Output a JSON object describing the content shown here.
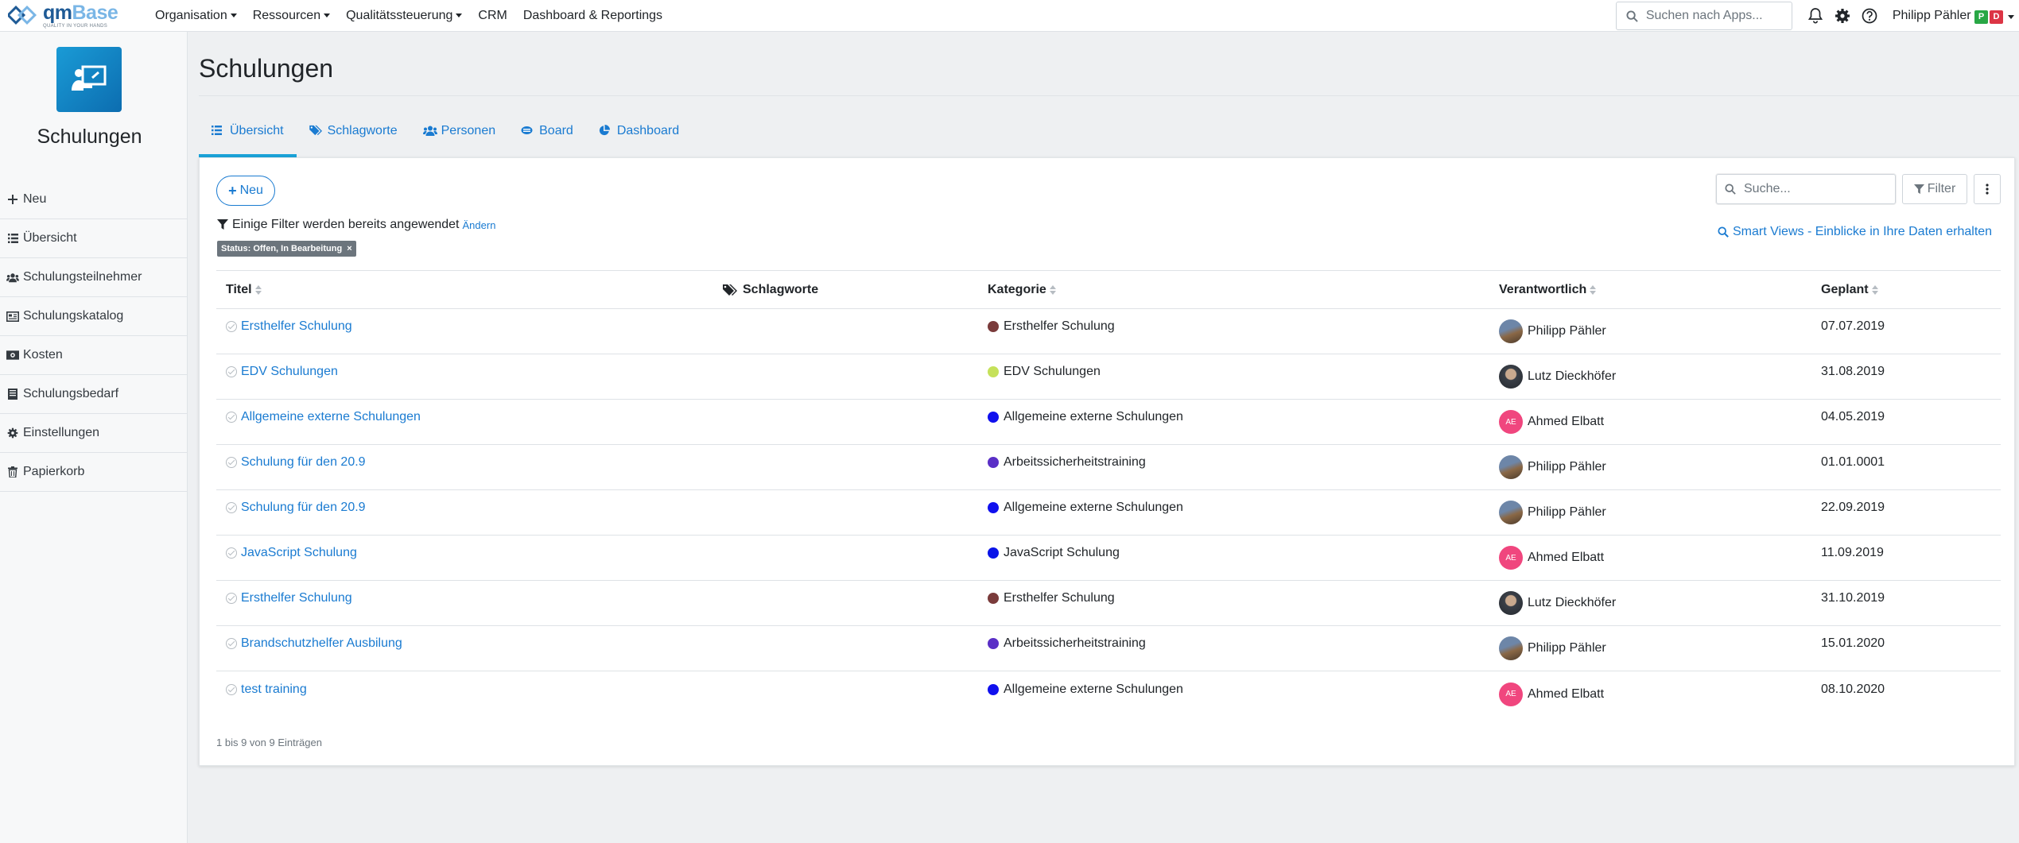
{
  "brand": {
    "name_part1": "qm",
    "name_part2": "Base",
    "tagline": "QUALITY IN YOUR HANDS"
  },
  "nav": {
    "items": [
      {
        "label": "Organisation",
        "dropdown": true
      },
      {
        "label": "Ressourcen",
        "dropdown": true
      },
      {
        "label": "Qualitätssteuerung",
        "dropdown": true
      },
      {
        "label": "CRM",
        "dropdown": false
      },
      {
        "label": "Dashboard & Reportings",
        "dropdown": false
      }
    ],
    "search_placeholder": "Suchen nach Apps...",
    "user_name": "Philipp Pähler",
    "badge_p": "P",
    "badge_d": "D"
  },
  "sidebar": {
    "app_title": "Schulungen",
    "items": [
      {
        "label": "Neu",
        "icon": "plus-icon"
      },
      {
        "label": "Übersicht",
        "icon": "list-icon"
      },
      {
        "label": "Schulungsteilnehmer",
        "icon": "users-icon"
      },
      {
        "label": "Schulungskatalog",
        "icon": "catalog-icon"
      },
      {
        "label": "Kosten",
        "icon": "money-icon"
      },
      {
        "label": "Schulungsbedarf",
        "icon": "book-icon"
      },
      {
        "label": "Einstellungen",
        "icon": "gear-icon"
      },
      {
        "label": "Papierkorb",
        "icon": "trash-icon"
      }
    ]
  },
  "page": {
    "title": "Schulungen"
  },
  "tabs": [
    {
      "label": "Übersicht",
      "icon": "list-icon",
      "active": true
    },
    {
      "label": "Schlagworte",
      "icon": "tags-icon",
      "active": false
    },
    {
      "label": "Personen",
      "icon": "users-icon",
      "active": false
    },
    {
      "label": "Board",
      "icon": "board-icon",
      "active": false
    },
    {
      "label": "Dashboard",
      "icon": "pie-chart-icon",
      "active": false
    }
  ],
  "toolbar": {
    "new_label": "Neu",
    "filter_note": "Einige Filter werden bereits angewendet",
    "filter_change": "Ändern",
    "chip_label": "Status: Offen, In Bearbeitung",
    "chip_remove": "×",
    "search_placeholder": "Suche...",
    "filter_label": "Filter",
    "smart_views": "Smart Views - Einblicke in Ihre Daten erhalten"
  },
  "table": {
    "headers": {
      "title": "Titel",
      "tags": "Schlagworte",
      "category": "Kategorie",
      "owner": "Verantwortlich",
      "planned": "Geplant"
    },
    "rows": [
      {
        "title": "Ersthelfer Schulung",
        "category": "Ersthelfer Schulung",
        "cat_color": "#7a3b3b",
        "owner": "Philipp Pähler",
        "avatar": "pp",
        "initials": "",
        "planned": "07.07.2019"
      },
      {
        "title": "EDV Schulungen",
        "category": "EDV Schulungen",
        "cat_color": "#c5e15a",
        "owner": "Lutz Dieckhöfer",
        "avatar": "ld",
        "initials": "",
        "planned": "31.08.2019"
      },
      {
        "title": "Allgemeine externe Schulungen",
        "category": "Allgemeine externe Schulungen",
        "cat_color": "#1010ee",
        "owner": "Ahmed Elbatt",
        "avatar": "ae",
        "initials": "AE",
        "planned": "04.05.2019"
      },
      {
        "title": "Schulung für den 20.9",
        "category": "Arbeitssicherheitstraining",
        "cat_color": "#5a2fc6",
        "owner": "Philipp Pähler",
        "avatar": "pp",
        "initials": "",
        "planned": "01.01.0001"
      },
      {
        "title": "Schulung für den 20.9",
        "category": "Allgemeine externe Schulungen",
        "cat_color": "#1010ee",
        "owner": "Philipp Pähler",
        "avatar": "pp",
        "initials": "",
        "planned": "22.09.2019"
      },
      {
        "title": "JavaScript Schulung",
        "category": "JavaScript Schulung",
        "cat_color": "#0a14e8",
        "owner": "Ahmed Elbatt",
        "avatar": "ae",
        "initials": "AE",
        "planned": "11.09.2019"
      },
      {
        "title": "Ersthelfer Schulung",
        "category": "Ersthelfer Schulung",
        "cat_color": "#7a3b3b",
        "owner": "Lutz Dieckhöfer",
        "avatar": "ld",
        "initials": "",
        "planned": "31.10.2019"
      },
      {
        "title": "Brandschutzhelfer Ausbilung",
        "category": "Arbeitssicherheitstraining",
        "cat_color": "#5a2fc6",
        "owner": "Philipp Pähler",
        "avatar": "pp",
        "initials": "",
        "planned": "15.01.2020"
      },
      {
        "title": "test training",
        "category": "Allgemeine externe Schulungen",
        "cat_color": "#1010ee",
        "owner": "Ahmed Elbatt",
        "avatar": "ae",
        "initials": "AE",
        "planned": "08.10.2020"
      }
    ],
    "footer": "1 bis 9 von 9 Einträgen"
  },
  "colors": {
    "accent": "#1a7bd1",
    "tab_active": "#1aa2d8",
    "app_icon": "#1a8fd0"
  }
}
